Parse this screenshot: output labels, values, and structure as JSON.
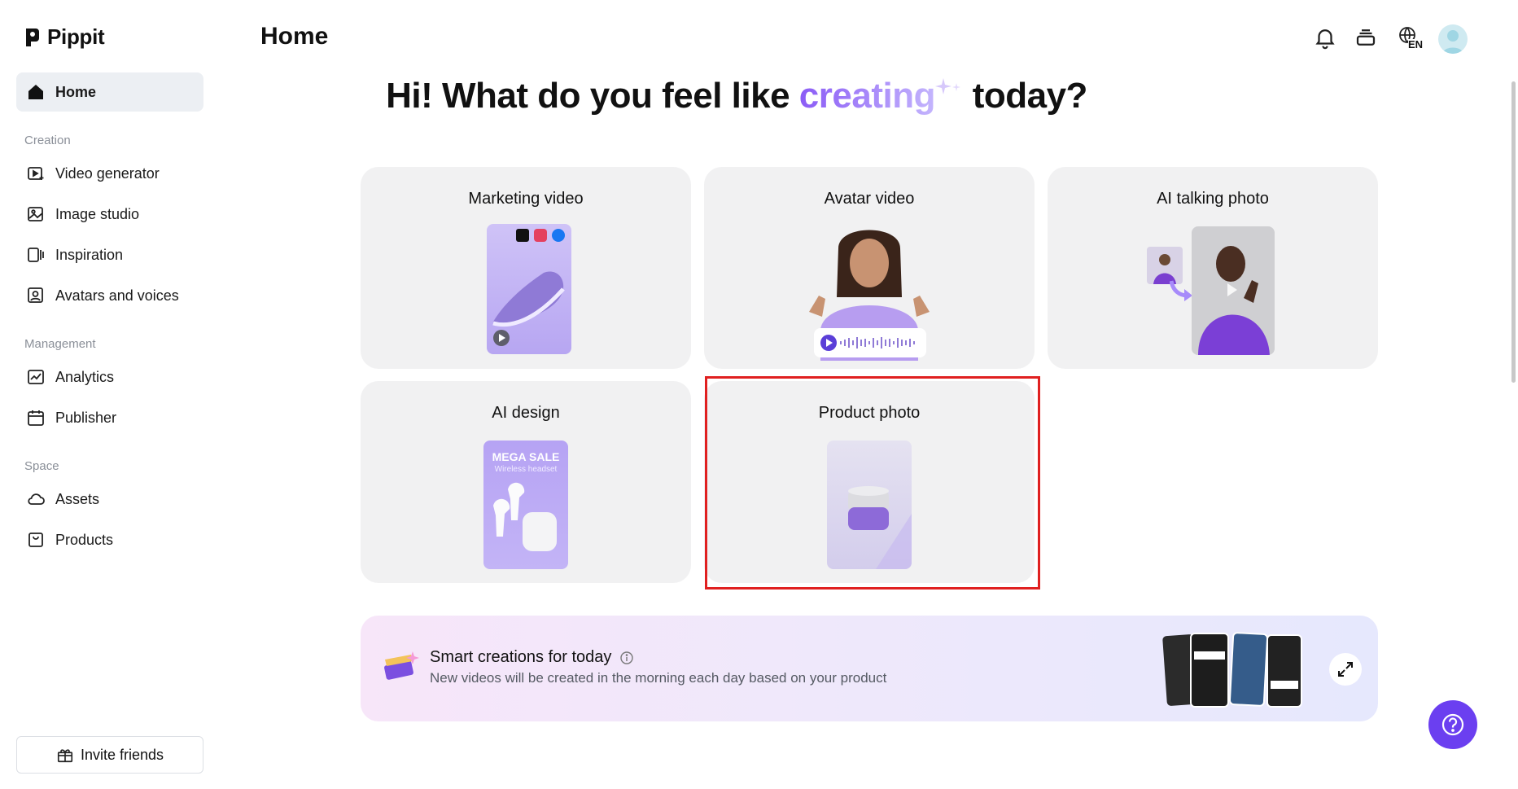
{
  "brand": {
    "name": "Pippit"
  },
  "sidebar": {
    "home": "Home",
    "sections": [
      {
        "label": "Creation",
        "items": [
          "Video generator",
          "Image studio",
          "Inspiration",
          "Avatars and voices"
        ]
      },
      {
        "label": "Management",
        "items": [
          "Analytics",
          "Publisher"
        ]
      },
      {
        "label": "Space",
        "items": [
          "Assets",
          "Products"
        ]
      }
    ],
    "invite": "Invite friends"
  },
  "header": {
    "title": "Home",
    "language_badge": "EN",
    "icons": [
      "bell-icon",
      "stack-icon",
      "globe-icon",
      "avatar"
    ]
  },
  "headline": {
    "before": "Hi! What do you feel like ",
    "accent": "creating",
    "after": " today?"
  },
  "cards": [
    {
      "title": "Marketing video"
    },
    {
      "title": "Avatar video"
    },
    {
      "title": "AI talking photo"
    },
    {
      "title": "AI design",
      "poster_title": "MEGA SALE",
      "poster_sub": "Wireless headset"
    },
    {
      "title": "Product photo",
      "selected": true
    }
  ],
  "banner": {
    "title": "Smart creations for today",
    "subtitle": "New videos will be created in the morning each day based on your product"
  },
  "colors": {
    "accent": "#8b5cf6",
    "active_nav_bg": "#eceff3",
    "card_bg": "#f1f1f2",
    "highlight": "#e02020",
    "help_fab": "#6b3ff0"
  }
}
